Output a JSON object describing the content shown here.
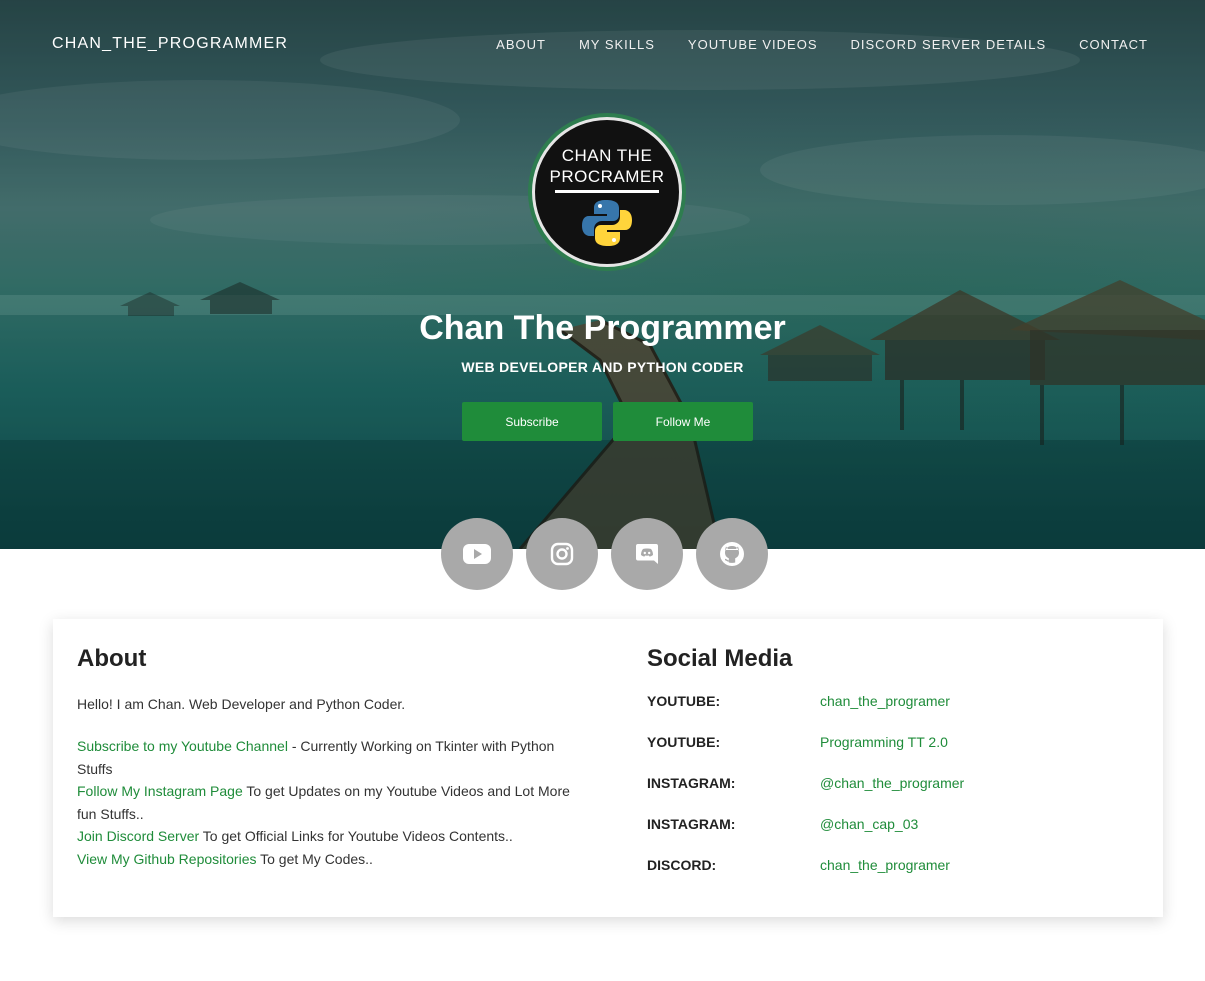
{
  "nav": {
    "brand": "CHAN_THE_PROGRAMMER",
    "links": [
      "ABOUT",
      "MY SKILLS",
      "YOUTUBE VIDEOS",
      "DISCORD SERVER DETAILS",
      "CONTACT"
    ]
  },
  "profile": {
    "avatar_line1": "CHAN THE",
    "avatar_line2": "PROCRAMER",
    "name": "Chan The Programmer",
    "tagline": "WEB DEVELOPER AND PYTHON CODER",
    "subscribe_label": "Subscribe",
    "follow_label": "Follow Me"
  },
  "social_icons": [
    "youtube-icon",
    "instagram-icon",
    "discord-icon",
    "github-icon"
  ],
  "about": {
    "heading": "About",
    "intro": "Hello! I am Chan. Web Developer and Python Coder.",
    "lines": [
      {
        "link": "Subscribe to my Youtube Channel",
        "text": " - Currently Working on Tkinter with Python Stuffs"
      },
      {
        "link": "Follow My Instagram Page",
        "text": " To get Updates on my Youtube Videos and Lot More fun Stuffs.."
      },
      {
        "link": "Join Discord Server",
        "text": " To get Official Links for Youtube Videos Contents.."
      },
      {
        "link": "View My Github Repositories",
        "text": " To get My Codes.."
      }
    ]
  },
  "social_media": {
    "heading": "Social Media",
    "rows": [
      {
        "label": "YOUTUBE:",
        "value": "chan_the_programer"
      },
      {
        "label": "YOUTUBE:",
        "value": "Programming TT 2.0"
      },
      {
        "label": "INSTAGRAM:",
        "value": "@chan_the_programer"
      },
      {
        "label": "INSTAGRAM:",
        "value": "@chan_cap_03"
      },
      {
        "label": "DISCORD:",
        "value": "chan_the_programer"
      }
    ]
  },
  "colors": {
    "accent": "#1f8c3a",
    "social_circle": "#a9a9a9"
  }
}
